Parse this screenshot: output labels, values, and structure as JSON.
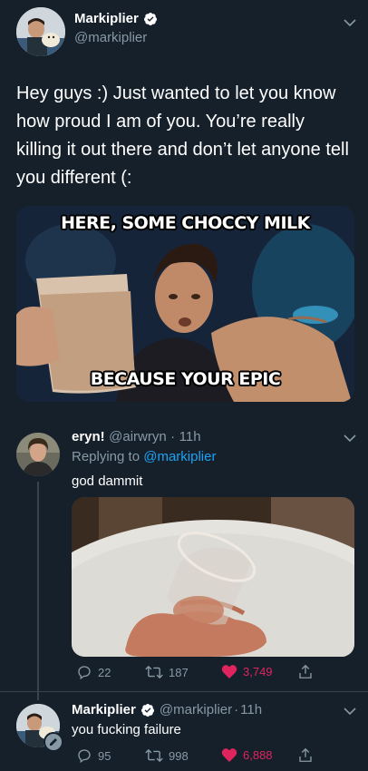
{
  "main_tweet": {
    "display_name": "Markiplier",
    "handle": "@markiplier",
    "text": "Hey guys :) Just wanted to let you know how proud I am of you. You’re really killing it out there and don’t let anyone tell you different (:",
    "meme_top": "HERE, SOME CHOCCY MILK",
    "meme_bottom": "BECAUSE YOUR EPIC"
  },
  "reply_1": {
    "display_name": "eryn!",
    "handle": "@airwryn",
    "separator": "·",
    "time": "11h",
    "replying_prefix": "Replying to",
    "replying_to": "@markiplier",
    "text": "god dammit",
    "replies": "22",
    "retweets": "187",
    "likes": "3,749"
  },
  "reply_2": {
    "display_name": "Markiplier",
    "handle": "@markiplier",
    "separator": "·",
    "time": "11h",
    "text": "you fucking failure",
    "replies": "95",
    "retweets": "998",
    "likes": "6,888"
  },
  "colors": {
    "background": "#15202b",
    "accent": "#1da1f2",
    "secondary_text": "#8899a6",
    "like": "#e0245e"
  },
  "icons": [
    "verified-icon",
    "chevron-down-icon",
    "reply-icon",
    "retweet-icon",
    "heart-icon",
    "share-icon",
    "edit-badge-icon"
  ]
}
